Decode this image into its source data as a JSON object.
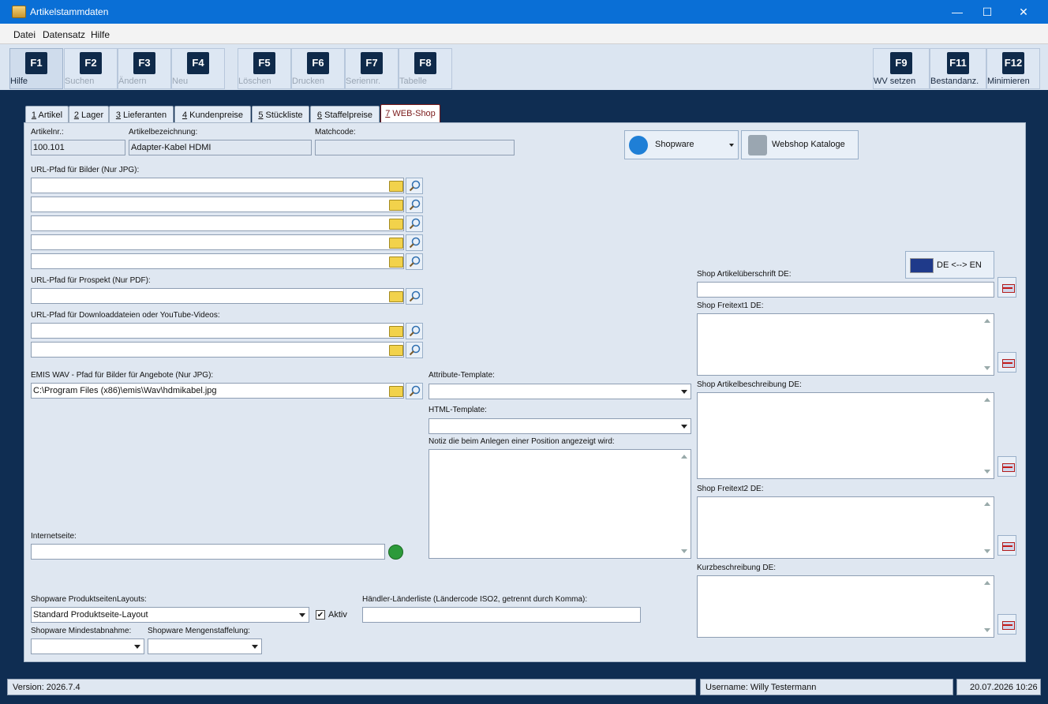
{
  "window": {
    "title": "Artikelstammdaten",
    "minimize_label": "—",
    "maximize_label": "☐",
    "close_label": "✕"
  },
  "menu": {
    "items": [
      "Datei",
      "Datensatz",
      "Hilfe"
    ]
  },
  "toolbar": {
    "keys": [
      {
        "key": "F1",
        "label": "Hilfe"
      },
      {
        "key": "F2",
        "label": "Suchen"
      },
      {
        "key": "F3",
        "label": "Ändern"
      },
      {
        "key": "F4",
        "label": "Neu"
      },
      {
        "key": "F5",
        "label": "Löschen"
      },
      {
        "key": "F6",
        "label": "Drucken"
      },
      {
        "key": "F7",
        "label": "Seriennr."
      },
      {
        "key": "F8",
        "label": "Tabelle"
      },
      {
        "key": "F9",
        "label": "WV setzen"
      },
      {
        "key": "F11",
        "label": "Bestandanz."
      },
      {
        "key": "F12",
        "label": "Minimieren"
      }
    ]
  },
  "tabs": [
    {
      "num": "1",
      "label": " Artikel"
    },
    {
      "num": "2",
      "label": " Lager"
    },
    {
      "num": "3",
      "label": " Lieferanten"
    },
    {
      "num": "4",
      "label": " Kundenpreise"
    },
    {
      "num": "5",
      "label": " Stückliste"
    },
    {
      "num": "6",
      "label": " Staffelpreise"
    },
    {
      "num": "7",
      "label": " WEB-Shop"
    }
  ],
  "form": {
    "artikelnr_label": "Artikelnr.:",
    "artikelnr_value": "100.101",
    "bezeichnung_label": "Artikelbezeichnung:",
    "bezeichnung_value": "Adapter-Kabel HDMI",
    "matchcode_label": "Matchcode:",
    "matchcode_value": "",
    "url_bilder_label": "URL-Pfad für Bilder (Nur JPG):",
    "url_prospekt_label": "URL-Pfad für Prospekt (Nur PDF):",
    "url_download_label": "URL-Pfad für Downloaddateien oder YouTube-Videos:",
    "emis_label": "EMIS WAV - Pfad für Bilder für Angebote (Nur JPG):",
    "emis_value": "C:\\Program Files (x86)\\emis\\Wav\\hdmikabel.jpg",
    "internet_label": "Internetseite:",
    "internet_value": "",
    "attribute_label": "Attribute-Template:",
    "html_label": "HTML-Template:",
    "notiz_label": "Notiz die beim Anlegen einer Position angezeigt wird:",
    "layouts_label": "Shopware ProduktseitenLayouts:",
    "layouts_value": "Standard Produktseite-Layout",
    "aktiv_label": "Aktiv",
    "haendler_label": "Händler-Länderliste (Ländercode ISO2, getrennt durch Komma):",
    "mindest_label": "Shopware Mindestabnahme:",
    "mengen_label": "Shopware Mengenstaffelung:"
  },
  "shop": {
    "shopware_label": "Shopware",
    "kataloge_label": "Webshop Kataloge",
    "translate_label": "DE <--> EN",
    "ueberschrift_label": "Shop Artikelüberschrift DE:",
    "freitext1_label": "Shop Freitext1 DE:",
    "beschreibung_label": "Shop Artikelbeschreibung DE:",
    "freitext2_label": "Shop Freitext2 DE:",
    "kurz_label": "Kurzbeschreibung DE:"
  },
  "status": {
    "version": "Version: 2026.7.4",
    "user": "Username: Willy Testermann",
    "datetime": "20.07.2026 10:26"
  },
  "colors": {
    "titlebar": "#0a6fd6",
    "frame": "#0f2d52",
    "panel": "#dfe7f1",
    "active_tab": "#7a1a1a"
  }
}
